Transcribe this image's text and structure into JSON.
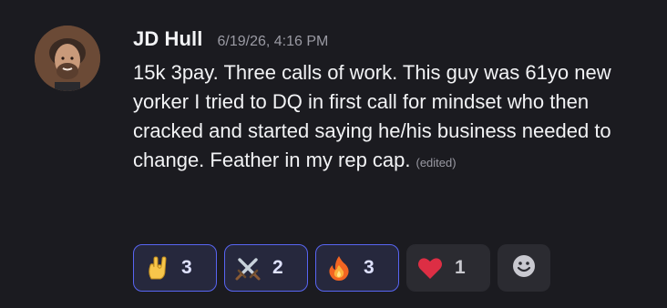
{
  "message": {
    "author": "JD Hull",
    "timestamp": "6/19/26, 4:16 PM",
    "text": "15k 3pay. Three calls of work. This guy was 61yo new yorker I tried to DQ in first call for mindset who then cracked and started saying he/his business needed to change. Feather in my rep cap.",
    "edited_label": "(edited)"
  },
  "reactions": [
    {
      "icon": "rock-on-hand-icon",
      "count": "3",
      "active": true
    },
    {
      "icon": "crossed-swords-icon",
      "count": "2",
      "active": true
    },
    {
      "icon": "fire-icon",
      "count": "3",
      "active": true
    },
    {
      "icon": "red-heart-icon",
      "count": "1",
      "active": false
    }
  ],
  "add_reaction": {
    "icon": "add-emoji-icon"
  },
  "colors": {
    "background": "#1b1b20",
    "active_reaction_border": "#5865f2",
    "active_reaction_bg": "#26283d",
    "inactive_reaction_bg": "#2b2b31"
  }
}
